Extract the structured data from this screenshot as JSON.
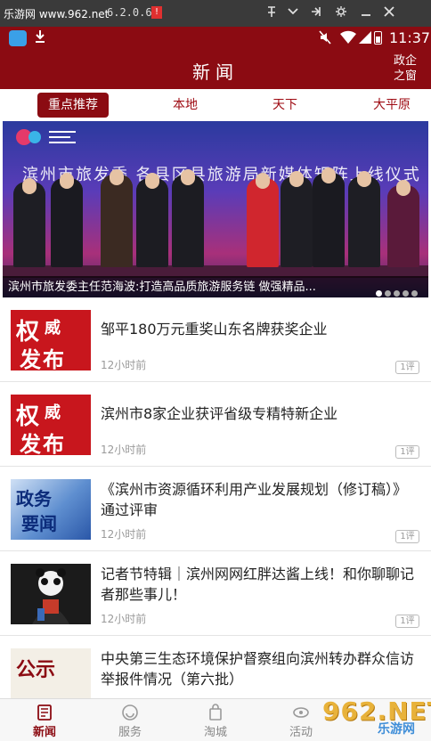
{
  "emulator": {
    "watermark": "乐游网 www.962.net",
    "app_version": "6.2.0.6",
    "warn_glyph": "!"
  },
  "status_bar": {
    "time": "11:37"
  },
  "header": {
    "title": "新闻",
    "corner_line1": "政企",
    "corner_line2": "之窗"
  },
  "tabs": [
    {
      "label": "重点推荐",
      "active": true
    },
    {
      "label": "本地",
      "active": false
    },
    {
      "label": "天下",
      "active": false
    },
    {
      "label": "大平原",
      "active": false
    }
  ],
  "banner": {
    "stage_text": "滨州市旅发委 各县区县旅游局新媒体矩阵上线仪式",
    "caption": "滨州市旅发委主任范海波:打造高品质旅游服务链 做强精品...",
    "slide_count": 5,
    "active_slide": 0
  },
  "news": [
    {
      "title": "邹平180万元重奖山东名牌获奖企业",
      "time": "12小时前",
      "comments": "1评",
      "thumb_type": "red",
      "thumb_text": [
        "权",
        "威",
        "发布"
      ]
    },
    {
      "title": "滨州市8家企业获评省级专精特新企业",
      "time": "12小时前",
      "comments": "1评",
      "thumb_type": "red",
      "thumb_text": [
        "权",
        "威",
        "发布"
      ]
    },
    {
      "title": "《滨州市资源循环利用产业发展规划（修订稿）》通过评审",
      "time": "12小时前",
      "comments": "1评",
      "thumb_type": "blue",
      "thumb_text": [
        "政务",
        "要闻"
      ]
    },
    {
      "title": "记者节特辑｜滨州网网红胖达酱上线！和你聊聊记者那些事儿！",
      "time": "12小时前",
      "comments": "1评",
      "thumb_type": "dark",
      "thumb_text": []
    },
    {
      "title": "中央第三生态环境保护督察组向滨州转办群众信访举报件情况（第六批）",
      "time": "",
      "comments": "",
      "thumb_type": "cream",
      "thumb_text": [
        "公示"
      ]
    }
  ],
  "bottom_nav": [
    {
      "label": "新闻",
      "icon": "news-icon",
      "active": true
    },
    {
      "label": "服务",
      "icon": "service-icon",
      "active": false
    },
    {
      "label": "淘城",
      "icon": "shopping-bag-icon",
      "active": false
    },
    {
      "label": "活动",
      "icon": "activity-icon",
      "active": false
    }
  ],
  "corner_watermark": {
    "big": "962.NET",
    "small": "乐游网"
  },
  "colors": {
    "brand": "#8b0b12",
    "tab_text": "#9e0a12"
  }
}
